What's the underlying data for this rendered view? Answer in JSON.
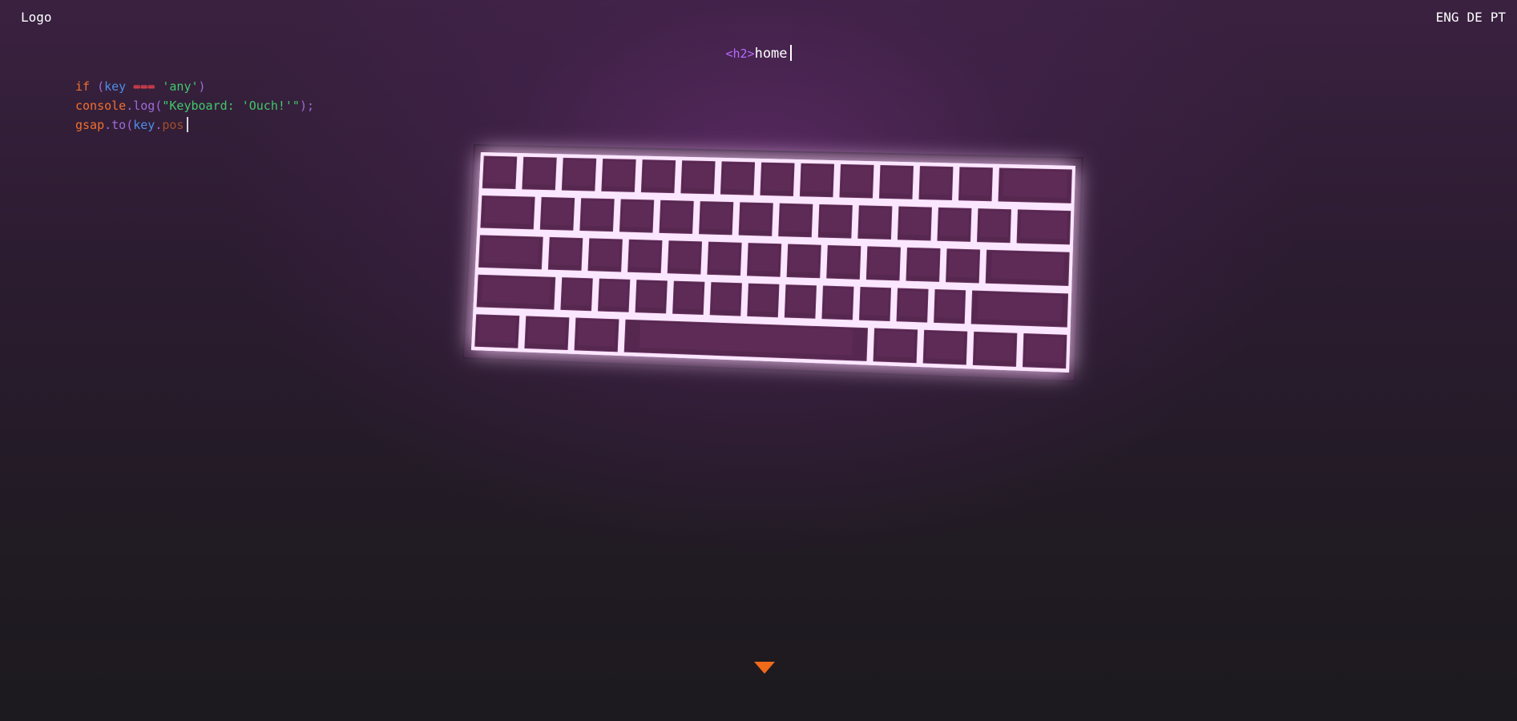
{
  "header": {
    "logo_label": "Logo",
    "languages": [
      "ENG",
      "DE",
      "PT"
    ]
  },
  "section": {
    "tag": "<h2>",
    "title": "home"
  },
  "code": {
    "line1": {
      "kw": "if",
      "open": " (",
      "var": "key",
      "op": "===",
      "str": "'any'",
      "close": ")"
    },
    "line2": {
      "obj": "console",
      "dot": ".",
      "fn": "log",
      "open": "(",
      "str": "\"Keyboard: 'Ouch!'\"",
      "close": ");"
    },
    "line3": {
      "obj": "gsap",
      "dot": ".",
      "fn": "to",
      "open": "(",
      "var": "key",
      "dot2": ".",
      "prop": "pos"
    }
  },
  "keyboard": {
    "glow_color": "#f8a8ff",
    "case_color": "#3a1e3e",
    "key_color": "#56274f",
    "rows": 5,
    "keys_per_row": [
      14,
      14,
      13,
      13,
      8
    ]
  },
  "colors": {
    "accent": "#f06a1a",
    "tag": "#b46cff"
  },
  "scroll": {
    "icon": "chevron-down-icon"
  }
}
